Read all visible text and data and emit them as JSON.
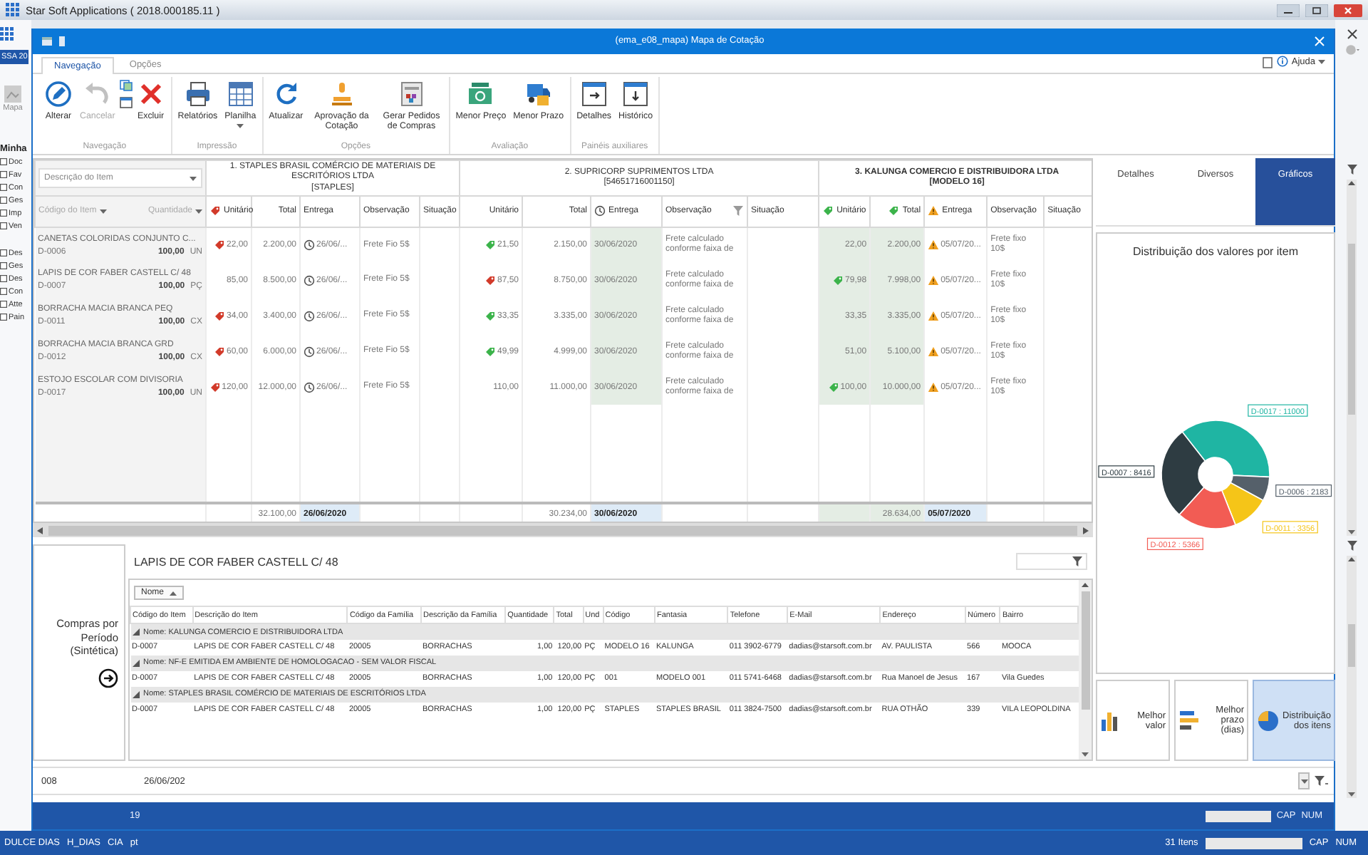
{
  "app_window": {
    "title": "Star Soft Applications ( 2018.000185.11 )"
  },
  "background_app": {
    "tab": "SSA 20",
    "button": "Mapa",
    "section": "Minha",
    "sidebar_groups": [
      [
        "Doc",
        "Fav",
        "Con",
        "Ges",
        "Imp",
        "Ven"
      ],
      [
        "Des",
        "Ges",
        "Des",
        "Con",
        "Atte",
        "Pain"
      ]
    ]
  },
  "window": {
    "title": "(ema_e08_mapa) Mapa de Cotação"
  },
  "ribbon_tabs": [
    {
      "label": "Navegação",
      "selected": true
    },
    {
      "label": "Opções",
      "selected": false
    }
  ],
  "help_menu": "Ajuda",
  "ribbon_groups": [
    {
      "label": "Navegação",
      "buttons": [
        {
          "kind": "large",
          "label": "Alterar",
          "disabled": false,
          "dropdown": false
        },
        {
          "kind": "large",
          "label": "Cancelar",
          "disabled": true,
          "dropdown": false
        },
        {
          "kind": "icon_stack",
          "disabled": false
        },
        {
          "kind": "large",
          "label": "Excluir",
          "disabled": false,
          "dropdown": false
        }
      ]
    },
    {
      "label": "Impressão",
      "buttons": [
        {
          "kind": "large",
          "label": "Relatórios",
          "disabled": false,
          "dropdown": false
        },
        {
          "kind": "large",
          "label": "Planilha",
          "disabled": false,
          "dropdown": true
        }
      ]
    },
    {
      "label": "Opções",
      "buttons": [
        {
          "kind": "large",
          "label": "Atualizar",
          "disabled": false,
          "dropdown": false
        },
        {
          "kind": "large",
          "label": "Aprovação da Cotação",
          "disabled": false,
          "dropdown": false
        },
        {
          "kind": "large",
          "label": "Gerar Pedidos de Compras",
          "disabled": false,
          "dropdown": false
        }
      ]
    },
    {
      "label": "Avaliação",
      "buttons": [
        {
          "kind": "large",
          "label": "Menor Preço",
          "disabled": false,
          "dropdown": false
        },
        {
          "kind": "large",
          "label": "Menor Prazo",
          "disabled": false,
          "dropdown": false
        }
      ]
    },
    {
      "label": "Painéis auxiliares",
      "buttons": [
        {
          "kind": "large",
          "label": "Detalhes",
          "disabled": false,
          "dropdown": false
        },
        {
          "kind": "large",
          "label": "Histórico",
          "disabled": false,
          "dropdown": false
        }
      ]
    }
  ],
  "grid": {
    "item_filter": {
      "placeholder": "Descrição do Item"
    },
    "item_columns": [
      "Código do Item",
      "Quantidade"
    ],
    "suppliers": [
      {
        "name": "1. STAPLES BRASIL COMÉRCIO DE MATERIAIS DE ESCRITÓRIOS LTDA",
        "code": "[STAPLES]",
        "best_price": false,
        "columns": [
          {
            "label": "Unitário",
            "worst": true,
            "best": false,
            "pending": false,
            "late": false,
            "filtered": false
          },
          {
            "label": "Total",
            "worst": false,
            "best": false,
            "pending": false,
            "late": false,
            "filtered": false
          },
          {
            "label": "Entrega",
            "worst": false,
            "best": false,
            "pending": false,
            "late": false,
            "filtered": false
          },
          {
            "label": "Observação",
            "worst": false,
            "best": false,
            "pending": false,
            "late": false,
            "filtered": false
          },
          {
            "label": "Situação",
            "worst": false,
            "best": false,
            "pending": false,
            "late": false,
            "filtered": false
          }
        ],
        "total": "32.100,00",
        "delivery_date": "26/06/2020"
      },
      {
        "name": "2. SUPRICORP SUPRIMENTOS LTDA",
        "code": "[54651716001150]",
        "best_price": false,
        "columns": [
          {
            "label": "Unitário",
            "worst": false,
            "best": false,
            "pending": false,
            "late": false,
            "filtered": false
          },
          {
            "label": "Total",
            "worst": false,
            "best": false,
            "pending": false,
            "late": false,
            "filtered": false
          },
          {
            "label": "Entrega",
            "worst": false,
            "best": false,
            "pending": true,
            "late": false,
            "filtered": false
          },
          {
            "label": "Observação",
            "worst": false,
            "best": false,
            "pending": false,
            "late": false,
            "filtered": true
          },
          {
            "label": "Situação",
            "worst": false,
            "best": false,
            "pending": false,
            "late": false,
            "filtered": false
          }
        ],
        "total": "30.234,00",
        "delivery_date": "30/06/2020"
      },
      {
        "name": "3. KALUNGA COMERCIO E DISTRIBUIDORA LTDA",
        "code": "[MODELO 16]",
        "best_price": true,
        "columns": [
          {
            "label": "Unitário",
            "worst": false,
            "best": true,
            "pending": false,
            "late": false,
            "filtered": false
          },
          {
            "label": "Total",
            "worst": false,
            "best": true,
            "pending": false,
            "late": false,
            "filtered": false
          },
          {
            "label": "Entrega",
            "worst": false,
            "best": false,
            "pending": false,
            "late": true,
            "filtered": false
          },
          {
            "label": "Observação",
            "worst": false,
            "best": false,
            "pending": false,
            "late": false,
            "filtered": false
          },
          {
            "label": "Situação",
            "worst": false,
            "best": false,
            "pending": false,
            "late": false,
            "filtered": false
          }
        ],
        "total": "28.634,00",
        "delivery_date": "05/07/2020"
      }
    ],
    "rows": [
      {
        "description": "CANETAS COLORIDAS CONJUNTO C...",
        "code": "D-0006",
        "quantity": "100,00",
        "unit": "UN",
        "quotes": [
          {
            "worst": true,
            "best": false,
            "unit_price": "22,00",
            "total": "2.200,00",
            "late": false,
            "confirmed": false,
            "delivery": "26/06/...",
            "note": "Frete Fio 5$"
          },
          {
            "worst": false,
            "best": true,
            "unit_price": "21,50",
            "total": "2.150,00",
            "late": false,
            "confirmed": true,
            "delivery": "30/06/2020",
            "note": "Frete calculado conforme faixa de"
          },
          {
            "worst": false,
            "best": false,
            "unit_price": "22,00",
            "total": "2.200,00",
            "late": true,
            "confirmed": false,
            "delivery": "05/07/20...",
            "note": "Frete fixo 10$"
          }
        ]
      },
      {
        "description": "LAPIS DE COR FABER CASTELL C/ 48",
        "code": "D-0007",
        "quantity": "100,00",
        "unit": "PÇ",
        "quotes": [
          {
            "worst": false,
            "best": false,
            "unit_price": "85,00",
            "total": "8.500,00",
            "late": false,
            "confirmed": false,
            "delivery": "26/06/...",
            "note": "Frete Fio 5$"
          },
          {
            "worst": true,
            "best": false,
            "unit_price": "87,50",
            "total": "8.750,00",
            "late": false,
            "confirmed": true,
            "delivery": "30/06/2020",
            "note": "Frete calculado conforme faixa de"
          },
          {
            "worst": false,
            "best": true,
            "unit_price": "79,98",
            "total": "7.998,00",
            "late": true,
            "confirmed": false,
            "delivery": "05/07/20...",
            "note": "Frete fixo 10$"
          }
        ]
      },
      {
        "description": "BORRACHA MACIA BRANCA PEQ",
        "code": "D-0011",
        "quantity": "100,00",
        "unit": "CX",
        "quotes": [
          {
            "worst": true,
            "best": false,
            "unit_price": "34,00",
            "total": "3.400,00",
            "late": false,
            "confirmed": false,
            "delivery": "26/06/...",
            "note": "Frete Fio 5$"
          },
          {
            "worst": false,
            "best": true,
            "unit_price": "33,35",
            "total": "3.335,00",
            "late": false,
            "confirmed": true,
            "delivery": "30/06/2020",
            "note": "Frete calculado conforme faixa de"
          },
          {
            "worst": false,
            "best": false,
            "unit_price": "33,35",
            "total": "3.335,00",
            "late": true,
            "confirmed": false,
            "delivery": "05/07/20...",
            "note": "Frete fixo 10$"
          }
        ]
      },
      {
        "description": "BORRACHA MACIA BRANCA GRD",
        "code": "D-0012",
        "quantity": "100,00",
        "unit": "CX",
        "quotes": [
          {
            "worst": true,
            "best": false,
            "unit_price": "60,00",
            "total": "6.000,00",
            "late": false,
            "confirmed": false,
            "delivery": "26/06/...",
            "note": "Frete Fio 5$"
          },
          {
            "worst": false,
            "best": true,
            "unit_price": "49,99",
            "total": "4.999,00",
            "late": false,
            "confirmed": true,
            "delivery": "30/06/2020",
            "note": "Frete calculado conforme faixa de"
          },
          {
            "worst": false,
            "best": false,
            "unit_price": "51,00",
            "total": "5.100,00",
            "late": true,
            "confirmed": false,
            "delivery": "05/07/20...",
            "note": "Frete fixo 10$"
          }
        ]
      },
      {
        "description": "ESTOJO ESCOLAR COM DIVISORIA",
        "code": "D-0017",
        "quantity": "100,00",
        "unit": "UN",
        "quotes": [
          {
            "worst": true,
            "best": false,
            "unit_price": "120,00",
            "total": "12.000,00",
            "late": false,
            "confirmed": false,
            "delivery": "26/06/...",
            "note": "Frete Fio 5$"
          },
          {
            "worst": false,
            "best": false,
            "unit_price": "110,00",
            "total": "11.000,00",
            "late": false,
            "confirmed": true,
            "delivery": "30/06/2020",
            "note": "Frete calculado conforme faixa de"
          },
          {
            "worst": false,
            "best": true,
            "unit_price": "100,00",
            "total": "10.000,00",
            "late": true,
            "confirmed": false,
            "delivery": "05/07/20...",
            "note": "Frete fixo 10$"
          }
        ]
      }
    ]
  },
  "chart_panel": {
    "tabs": [
      {
        "label": "Detalhes",
        "selected": false
      },
      {
        "label": "Diversos",
        "selected": false
      },
      {
        "label": "Gráficos",
        "selected": true
      }
    ],
    "chart_data": {
      "type": "donut",
      "title": "Distribuição dos valores por item",
      "series": [
        {
          "values": [
            36.28,
            7.2,
            11.07,
            17.7,
            27.75
          ]
        }
      ],
      "value_labels": [
        "D-0017 : 11000",
        "D-0006 : 2183",
        "D-0011 : 3356",
        "D-0012 : 5366",
        "D-0007 : 8416"
      ]
    },
    "views": [
      {
        "label": "Melhor valor",
        "selected": false
      },
      {
        "label": "Melhor prazo (dias)",
        "selected": false
      },
      {
        "label": "Distribuição dos itens",
        "selected": true
      }
    ]
  },
  "detail": {
    "side_label": "Compras por Período (Sintética)",
    "title": "LAPIS DE COR FABER CASTELL C/ 48",
    "group_by": "Nome",
    "columns": [
      "Código do Item",
      "Descrição do Item",
      "Código da Família",
      "Descrição da Família",
      "Quantidade",
      "Total",
      "Und",
      "Código",
      "Fantasia",
      "Telefone",
      "E-Mail",
      "Endereço",
      "Número",
      "Bairro"
    ],
    "groups": [
      {
        "label": "Nome: KALUNGA COMERCIO E DISTRIBUIDORA LTDA",
        "expanded": true,
        "rows": [
          [
            "D-0007",
            "LAPIS DE COR FABER CASTELL C/ 48",
            "20005",
            "BORRACHAS",
            "1,00",
            "120,00",
            "PÇ",
            "MODELO 16",
            "KALUNGA",
            "011 3902-6779",
            "dadias@starsoft.com.br",
            "AV. PAULISTA",
            "566",
            "MOOCA"
          ]
        ]
      },
      {
        "label": "Nome: NF-E EMITIDA EM AMBIENTE DE HOMOLOGACAO - SEM VALOR FISCAL",
        "expanded": true,
        "rows": [
          [
            "D-0007",
            "LAPIS DE COR FABER CASTELL C/ 48",
            "20005",
            "BORRACHAS",
            "1,00",
            "120,00",
            "PÇ",
            "001",
            "MODELO 001",
            "011 5741-6468",
            "dadias@starsoft.com.br",
            "Rua Manoel de Jesus",
            "167",
            "Vila Guedes"
          ]
        ]
      },
      {
        "label": "Nome: STAPLES BRASIL COMÉRCIO DE MATERIAIS DE ESCRITÓRIOS LTDA",
        "expanded": true,
        "rows": [
          [
            "D-0007",
            "LAPIS DE COR FABER CASTELL C/ 48",
            "20005",
            "BORRACHAS",
            "1,00",
            "120,00",
            "PÇ",
            "STAPLES",
            "STAPLES BRASIL",
            "011 3824-7500",
            "dadias@starsoft.com.br",
            "RUA OTHÃO",
            "339",
            "VILA LEOPOLDINA"
          ]
        ]
      }
    ]
  },
  "filter_row": [
    "008",
    "26/06/202"
  ],
  "inner_status": {
    "count": "19",
    "caps": "CAP",
    "num": "NUM"
  },
  "status_bar": {
    "items": [
      "DULCE DIAS",
      "H_DIAS",
      "CIA",
      "pt"
    ],
    "count": "31 Itens",
    "caps": "CAP",
    "num": "NUM"
  }
}
